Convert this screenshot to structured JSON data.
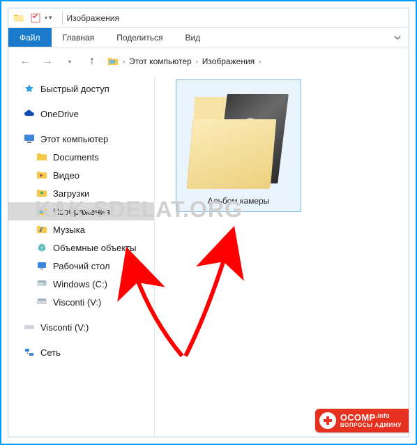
{
  "titlebar": {
    "title": "Изображения"
  },
  "ribbon": {
    "file": "Файл",
    "tabs": [
      "Главная",
      "Поделиться",
      "Вид"
    ]
  },
  "breadcrumb": {
    "items": [
      "Этот компьютер",
      "Изображения"
    ]
  },
  "sidebar": {
    "quick_access": "Быстрый доступ",
    "onedrive": "OneDrive",
    "this_pc": "Этот компьютер",
    "this_pc_children": [
      {
        "label": "Documents",
        "icon": "folder"
      },
      {
        "label": "Видео",
        "icon": "folder-video"
      },
      {
        "label": "Загрузки",
        "icon": "folder-downloads"
      },
      {
        "label": "Изображения",
        "icon": "folder-pictures",
        "selected": true
      },
      {
        "label": "Музыка",
        "icon": "folder-music"
      },
      {
        "label": "Объемные объекты",
        "icon": "cube"
      },
      {
        "label": "Рабочий стол",
        "icon": "desktop"
      },
      {
        "label": "Windows (C:)",
        "icon": "drive"
      },
      {
        "label": "Visconti (V:)",
        "icon": "drive"
      }
    ],
    "removable": "Visconti (V:)",
    "network": "Сеть"
  },
  "content": {
    "folder_label": "Альбом камеры"
  },
  "watermark": "KAK-SDELAT.ORG",
  "badge": {
    "brand": "OCOMP",
    "tld": ".info",
    "sub": "ВОПРОСЫ АДМИНУ"
  }
}
